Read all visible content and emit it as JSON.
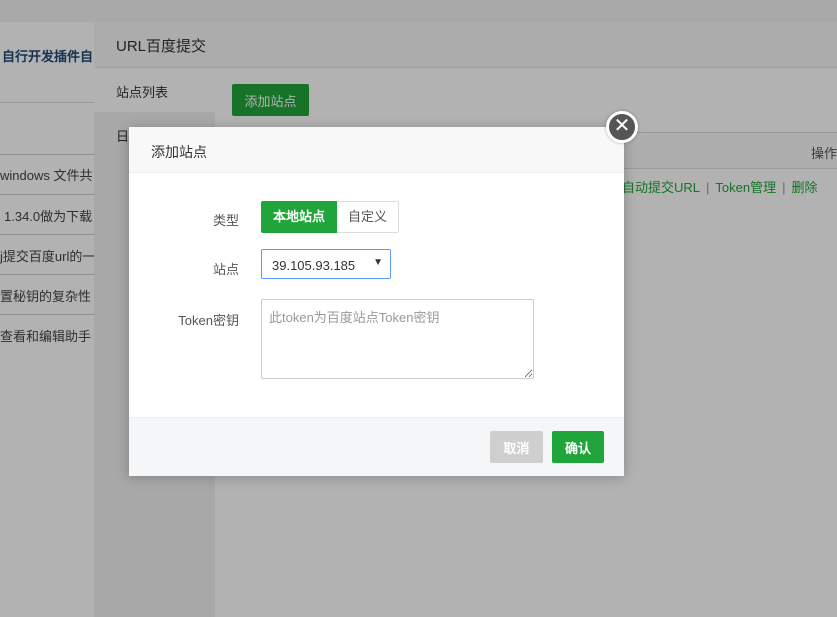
{
  "background": {
    "header_text": "自行开发插件自",
    "list_items": [
      "windows 文件共",
      "1.34.0做为下载",
      "j提交百度url的一",
      "置秘钥的复杂性",
      "查看和编辑助手"
    ]
  },
  "plugin": {
    "title": "URL百度提交",
    "tabs": [
      "站点列表",
      "日"
    ],
    "add_site_label": "添加站点",
    "table_header_action": "操作",
    "row_actions": [
      "自动提交URL",
      "Token管理",
      "删除"
    ],
    "separator": "|"
  },
  "modal": {
    "title": "添加站点",
    "close_glyph": "✕",
    "type_label": "类型",
    "type_options": [
      "本地站点",
      "自定义"
    ],
    "type_selected": "本地站点",
    "site_label": "站点",
    "site_value": "39.105.93.185",
    "token_label": "Token密钥",
    "token_placeholder": "此token为百度站点Token密钥",
    "cancel_label": "取消",
    "confirm_label": "确认"
  },
  "colors": {
    "accent": "#20a53a",
    "select_border": "#5a9bff"
  }
}
